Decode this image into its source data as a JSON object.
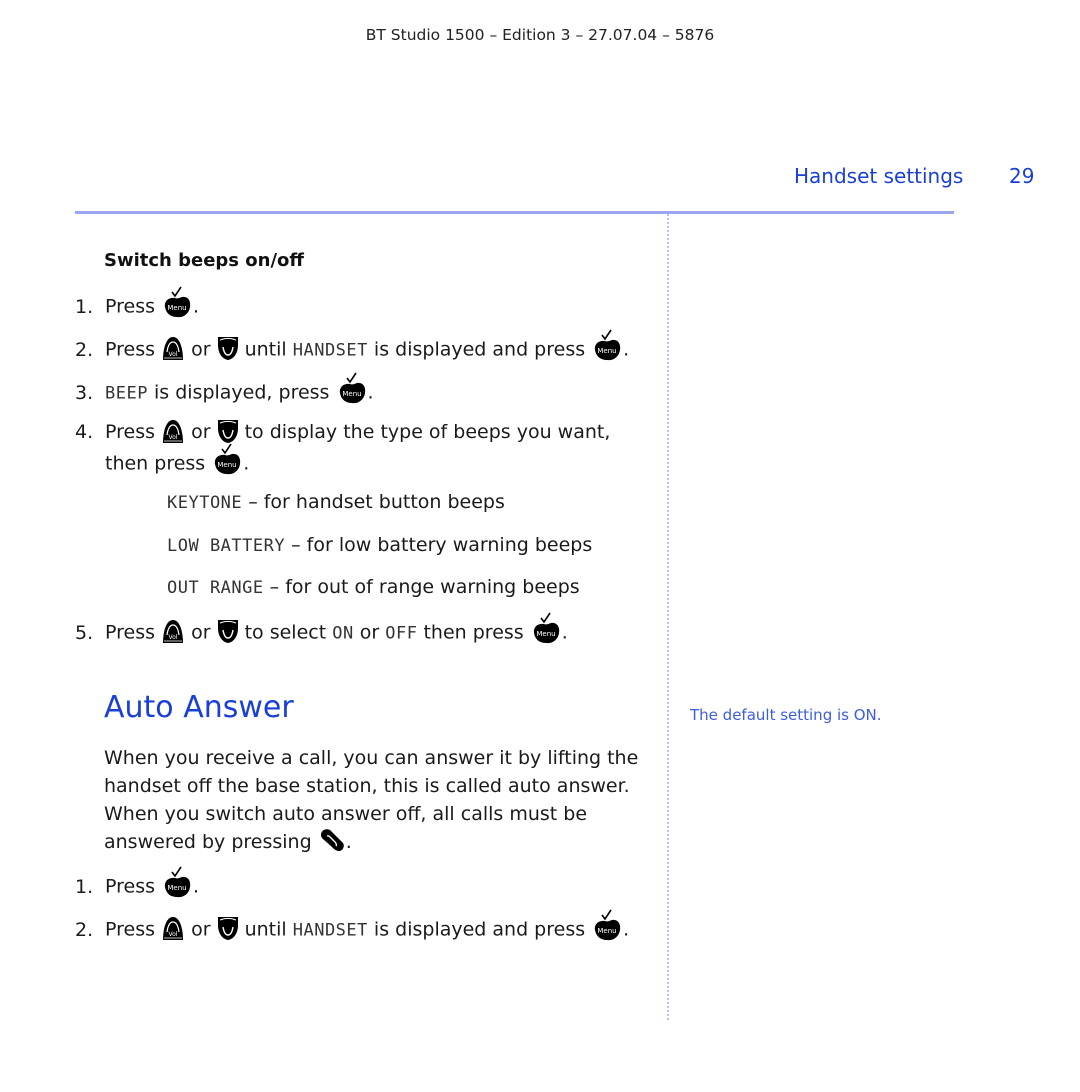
{
  "header": {
    "meta": "BT Studio 1500 – Edition 3 – 27.07.04 – 5876",
    "section_title": "Handset settings",
    "page_number": "29"
  },
  "switch_beeps": {
    "title": "Switch beeps on/off",
    "steps": [
      {
        "num": "1.",
        "parts": {
          "a": "Press ",
          "b": "."
        }
      },
      {
        "num": "2.",
        "parts": {
          "a": "Press ",
          "or": " or ",
          "until": " until ",
          "lcd": "HANDSET",
          "rest": " is displayed and press ",
          "end": "."
        }
      },
      {
        "num": "3.",
        "parts": {
          "lcd": "BEEP",
          "rest": " is displayed, press ",
          "end": "."
        }
      },
      {
        "num": "4.",
        "parts": {
          "a": "Press ",
          "or": " or ",
          "rest": " to display the type of beeps you want,",
          "line2": "then press ",
          "end": "."
        }
      },
      {
        "num": "5.",
        "parts": {
          "a": "Press ",
          "or": " or ",
          "rest1": " to select ",
          "lcd_on": "ON",
          "or2": " or ",
          "lcd_off": "OFF",
          "rest2": " then press ",
          "end": "."
        }
      }
    ],
    "options": [
      {
        "lcd": "KEYTONE",
        "desc": " – for handset button beeps"
      },
      {
        "lcd": "LOW BATTERY",
        "desc": " – for low battery warning beeps"
      },
      {
        "lcd": "OUT RANGE",
        "desc": " – for out of range warning beeps"
      }
    ]
  },
  "auto_answer": {
    "title": "Auto Answer",
    "paragraph": "When you receive a call, you can answer it by lifting the handset off the base station, this is called auto answer. When you switch auto answer off, all calls must be answered by pressing ",
    "paragraph_end": ".",
    "steps": [
      {
        "num": "1.",
        "parts": {
          "a": "Press ",
          "b": "."
        }
      },
      {
        "num": "2.",
        "parts": {
          "a": "Press ",
          "or": " or ",
          "until": " until ",
          "lcd": "HANDSET",
          "rest": " is displayed and press ",
          "end": "."
        }
      }
    ],
    "sidenote": "The default setting is ON."
  },
  "icons": {
    "menu_label": "Menu",
    "vol_label": "Vol"
  },
  "colors": {
    "accent_blue": "#1a3fd6",
    "rule_blue": "#9aa6f2",
    "note_blue": "#3d5ce0"
  }
}
